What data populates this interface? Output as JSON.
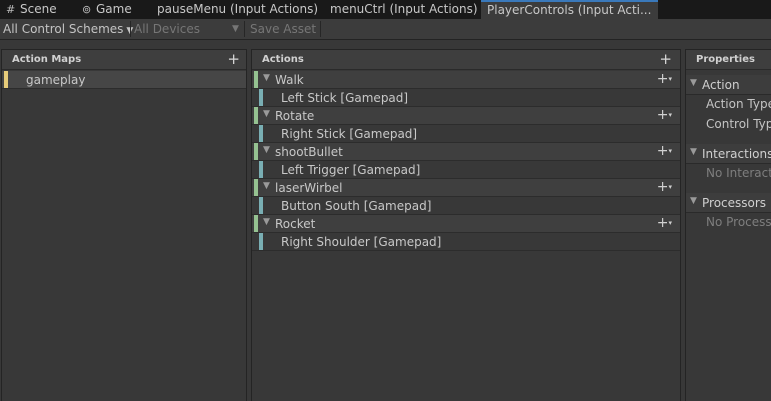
{
  "tabs": [
    {
      "icon": "#",
      "icon_name": "scene-icon",
      "label": "Scene"
    },
    {
      "icon": "⊚",
      "icon_name": "gamepad-icon",
      "label": "Game"
    },
    {
      "label": "pauseMenu (Input Actions)"
    },
    {
      "label": "menuCtrl (Input Actions)"
    },
    {
      "label": "PlayerControls (Input Acti..."
    }
  ],
  "toolbar": {
    "control_schemes": "All Control Schemes",
    "devices": "All Devices",
    "save_asset": "Save Asset"
  },
  "action_maps": {
    "title": "Action Maps",
    "items": [
      {
        "label": "gameplay",
        "selected": true
      }
    ]
  },
  "actions": {
    "title": "Actions",
    "items": [
      {
        "name": "Walk",
        "binding": "Left Stick [Gamepad]"
      },
      {
        "name": "Rotate",
        "binding": "Right Stick [Gamepad]"
      },
      {
        "name": "shootBullet",
        "binding": "Left Trigger [Gamepad]"
      },
      {
        "name": "laserWirbel",
        "binding": "Button South [Gamepad]"
      },
      {
        "name": "Rocket",
        "binding": "Right Shoulder [Gamepad]"
      }
    ]
  },
  "properties": {
    "title": "Properties",
    "action_section": "Action",
    "action_type": "Action Type",
    "control_type": "Control Typ",
    "interactions_section": "Interactions",
    "no_interactions": "No Interactio",
    "processors_section": "Processors",
    "no_processors": "No Processo"
  },
  "colors": {
    "map_stripe": "#e7cc7a",
    "action_stripe": "#95c291",
    "binding_stripe": "#79aeb3",
    "active_tab_accent": "#3a79bb"
  }
}
